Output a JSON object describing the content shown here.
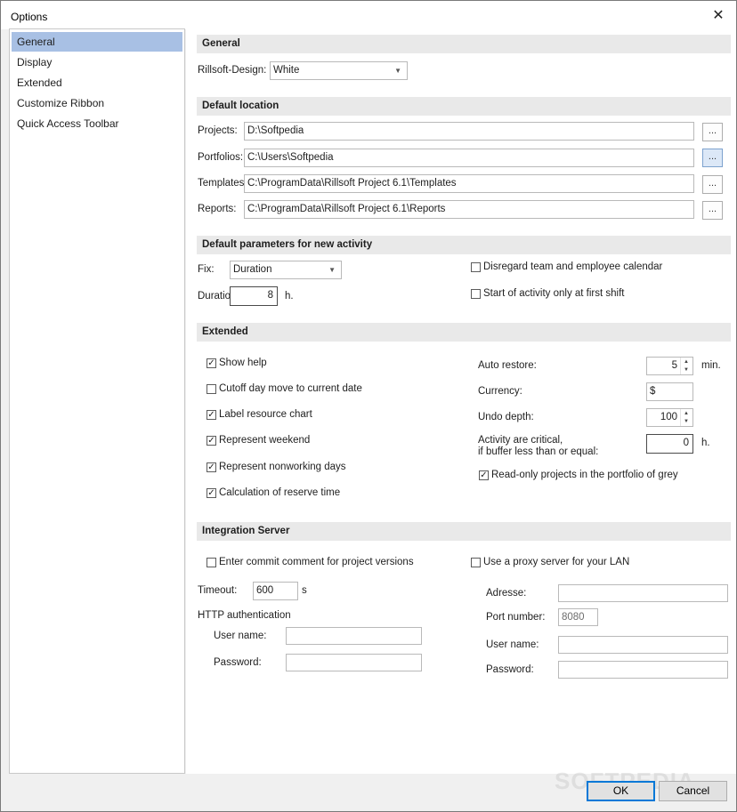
{
  "window": {
    "title": "Options",
    "close_glyph": "✕",
    "watermark": "SOFTPEDIA"
  },
  "nav": {
    "items": [
      {
        "label": "General",
        "selected": true
      },
      {
        "label": "Display",
        "selected": false
      },
      {
        "label": "Extended",
        "selected": false
      },
      {
        "label": "Customize Ribbon",
        "selected": false
      },
      {
        "label": "Quick Access Toolbar",
        "selected": false
      }
    ]
  },
  "general": {
    "heading": "General",
    "design_label": "Rillsoft-Design:",
    "design_value": "White"
  },
  "location": {
    "heading": "Default location",
    "browse_label": "...",
    "rows": [
      {
        "label": "Projects:",
        "value": "D:\\Softpedia"
      },
      {
        "label": "Portfolios:",
        "value": "C:\\Users\\Softpedia"
      },
      {
        "label": "Templates:",
        "value": "C:\\ProgramData\\Rillsoft Project 6.1\\Templates"
      },
      {
        "label": "Reports:",
        "value": "C:\\ProgramData\\Rillsoft Project 6.1\\Reports"
      }
    ]
  },
  "params": {
    "heading": "Default parameters for new activity",
    "fix_label": "Fix:",
    "fix_value": "Duration",
    "duration_label": "Duration",
    "duration_value": "8",
    "duration_unit": "h.",
    "disregard_label": "Disregard team and employee calendar",
    "disregard_checked": false,
    "first_shift_label": "Start of activity only at first shift",
    "first_shift_checked": false
  },
  "extended": {
    "heading": "Extended",
    "checks": [
      {
        "label": "Show help",
        "checked": true
      },
      {
        "label": "Cutoff day move to current date",
        "checked": false
      },
      {
        "label": "Label resource chart",
        "checked": true
      },
      {
        "label": "Represent weekend",
        "checked": true
      },
      {
        "label": "Represent nonworking days",
        "checked": true
      },
      {
        "label": "Calculation of reserve time",
        "checked": true
      }
    ],
    "auto_restore_label": "Auto restore:",
    "auto_restore_value": "5",
    "auto_restore_unit": "min.",
    "currency_label": "Currency:",
    "currency_value": "$",
    "undo_label": "Undo depth:",
    "undo_value": "100",
    "critical_label_1": "Activity are critical,",
    "critical_label_2": "if buffer less than or equal:",
    "critical_value": "0",
    "critical_unit": "h.",
    "readonly_label": "Read-only projects in the portfolio of grey",
    "readonly_checked": true
  },
  "integration": {
    "heading": "Integration Server",
    "commit_label": "Enter commit comment for project versions",
    "commit_checked": false,
    "timeout_label": "Timeout:",
    "timeout_value": "600",
    "timeout_unit": "s",
    "http_label": "HTTP authentication",
    "user_label": "User name:",
    "user_value": "",
    "pass_label": "Password:",
    "pass_value": "",
    "proxy_label": "Use a proxy server for your LAN",
    "proxy_checked": false,
    "adresse_label": "Adresse:",
    "adresse_value": "",
    "port_label": "Port number:",
    "port_value": "8080",
    "proxy_user_label": "User name:",
    "proxy_user_value": "",
    "proxy_pass_label": "Password:",
    "proxy_pass_value": ""
  },
  "buttons": {
    "ok": "OK",
    "cancel": "Cancel"
  },
  "icons": {
    "check": "✓",
    "dropdown": "▼",
    "spin_up": "▲",
    "spin_down": "▼"
  }
}
